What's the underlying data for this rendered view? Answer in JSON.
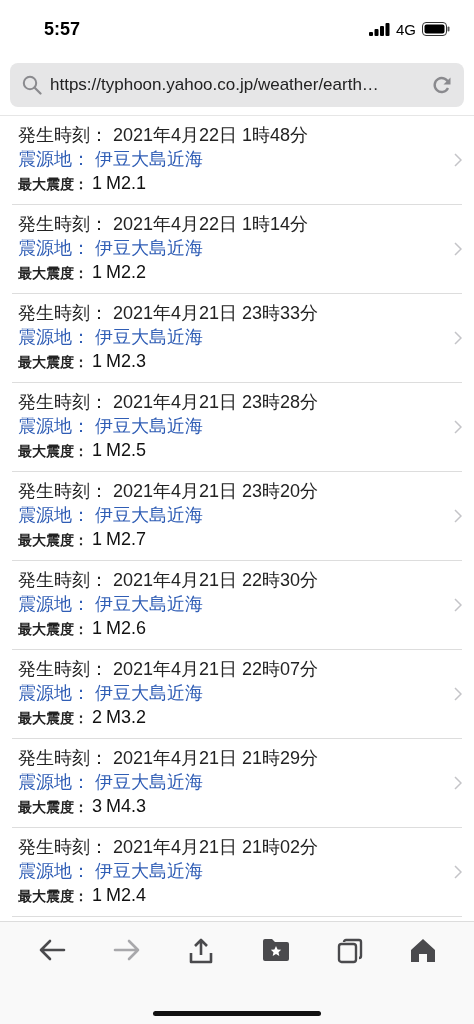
{
  "status_bar": {
    "time": "5:57",
    "network": "4G"
  },
  "address_bar": {
    "url": "https://typhoon.yahoo.co.jp/weather/earth…"
  },
  "quakes": [
    {
      "time_label": "発生時刻：",
      "time": "2021年4月22日 1時48分",
      "place_label": "震源地：",
      "place": "伊豆大島近海",
      "intensity_label": "最大震度：",
      "intensity": "1",
      "magnitude": "M2.1"
    },
    {
      "time_label": "発生時刻：",
      "time": "2021年4月22日 1時14分",
      "place_label": "震源地：",
      "place": "伊豆大島近海",
      "intensity_label": "最大震度：",
      "intensity": "1",
      "magnitude": "M2.2"
    },
    {
      "time_label": "発生時刻：",
      "time": "2021年4月21日 23時33分",
      "place_label": "震源地：",
      "place": "伊豆大島近海",
      "intensity_label": "最大震度：",
      "intensity": "1",
      "magnitude": "M2.3"
    },
    {
      "time_label": "発生時刻：",
      "time": "2021年4月21日 23時28分",
      "place_label": "震源地：",
      "place": "伊豆大島近海",
      "intensity_label": "最大震度：",
      "intensity": "1",
      "magnitude": "M2.5"
    },
    {
      "time_label": "発生時刻：",
      "time": "2021年4月21日 23時20分",
      "place_label": "震源地：",
      "place": "伊豆大島近海",
      "intensity_label": "最大震度：",
      "intensity": "1",
      "magnitude": "M2.7"
    },
    {
      "time_label": "発生時刻：",
      "time": "2021年4月21日 22時30分",
      "place_label": "震源地：",
      "place": "伊豆大島近海",
      "intensity_label": "最大震度：",
      "intensity": "1",
      "magnitude": "M2.6"
    },
    {
      "time_label": "発生時刻：",
      "time": "2021年4月21日 22時07分",
      "place_label": "震源地：",
      "place": "伊豆大島近海",
      "intensity_label": "最大震度：",
      "intensity": "2",
      "magnitude": "M3.2"
    },
    {
      "time_label": "発生時刻：",
      "time": "2021年4月21日 21時29分",
      "place_label": "震源地：",
      "place": "伊豆大島近海",
      "intensity_label": "最大震度：",
      "intensity": "3",
      "magnitude": "M4.3"
    },
    {
      "time_label": "発生時刻：",
      "time": "2021年4月21日 21時02分",
      "place_label": "震源地：",
      "place": "伊豆大島近海",
      "intensity_label": "最大震度：",
      "intensity": "1",
      "magnitude": "M2.4"
    }
  ],
  "toolbar": [
    {
      "kind": "back",
      "disabled": false
    },
    {
      "kind": "forward",
      "disabled": true
    },
    {
      "kind": "share",
      "disabled": false
    },
    {
      "kind": "bookmarks",
      "disabled": false
    },
    {
      "kind": "tabs",
      "disabled": false
    },
    {
      "kind": "home",
      "disabled": false
    }
  ]
}
